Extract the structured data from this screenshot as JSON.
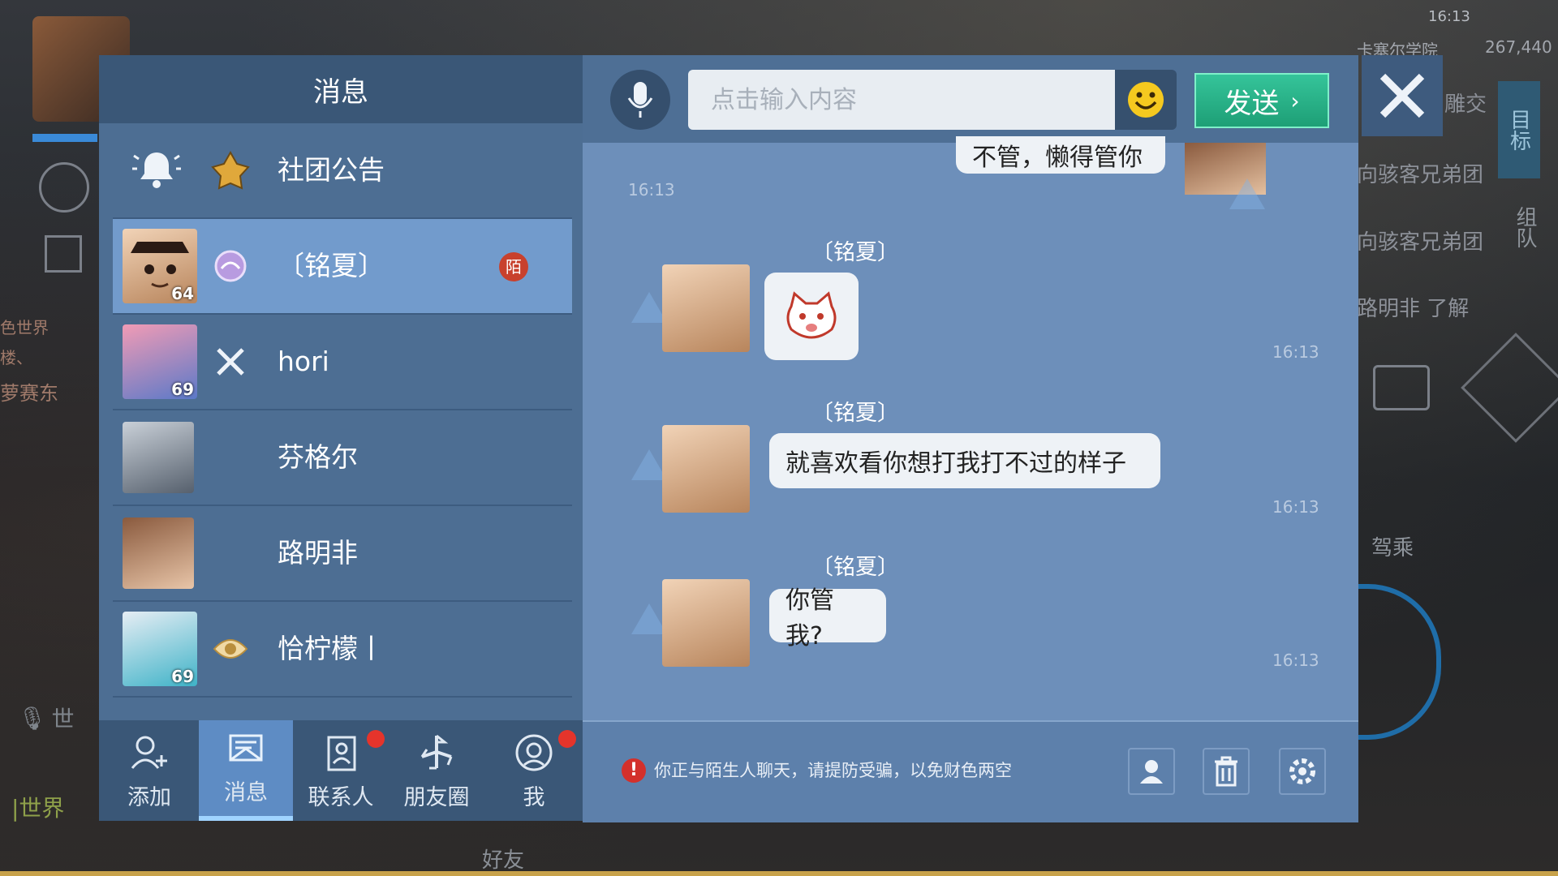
{
  "background": {
    "status_time": "16:13",
    "location": "卡塞尔学院",
    "coins": "267,440",
    "right_side_lines": [
      "雕交",
      "向骇客兄弟团",
      "向骇客兄弟团",
      "路明非 了解"
    ],
    "right_tab_goal": "目标",
    "right_tab_team": "组队",
    "ride_label": "驾乘",
    "left_lines": [
      "色世界",
      "楼、",
      "萝赛东"
    ],
    "world_channel": "|世界",
    "world_voice": "世",
    "friends_label": "好友"
  },
  "left_panel": {
    "title": "消息",
    "conversations": [
      {
        "name": "社团公告",
        "level": "",
        "stranger_badge": ""
      },
      {
        "name": "〔铭夏〕",
        "level": "64",
        "stranger_badge": "陌"
      },
      {
        "name": "hori",
        "level": "69",
        "stranger_badge": ""
      },
      {
        "name": "芬格尔",
        "level": "",
        "stranger_badge": ""
      },
      {
        "name": "路明非",
        "level": "",
        "stranger_badge": ""
      },
      {
        "name": "恰柠檬丨",
        "level": "69",
        "stranger_badge": ""
      }
    ]
  },
  "bottom_nav": {
    "items": [
      {
        "label": "添加",
        "icon": "add-friend-icon"
      },
      {
        "label": "消息",
        "icon": "message-icon"
      },
      {
        "label": "联系人",
        "icon": "contacts-icon"
      },
      {
        "label": "朋友圈",
        "icon": "moments-icon"
      },
      {
        "label": "我",
        "icon": "profile-icon"
      }
    ]
  },
  "chat": {
    "input_placeholder": "点击输入内容",
    "send_label": "发送",
    "top_partial_message": "不管，懒得管你",
    "top_time": "16:13",
    "messages": [
      {
        "sender": "〔铭夏〕",
        "type": "sticker",
        "text": "",
        "time": "16:13"
      },
      {
        "sender": "〔铭夏〕",
        "type": "text",
        "text": "就喜欢看你想打我打不过的样子",
        "time": "16:13"
      },
      {
        "sender": "〔铭夏〕",
        "type": "text",
        "text": "你管我?",
        "time": "16:13"
      }
    ],
    "warning": "你正与陌生人聊天，请提防受骗，以免财色两空"
  },
  "colors": {
    "panel_blue": "#4d6e93",
    "active_row": "#729bcc",
    "send_green": "#1e9f76",
    "alert_red": "#e5342b"
  }
}
